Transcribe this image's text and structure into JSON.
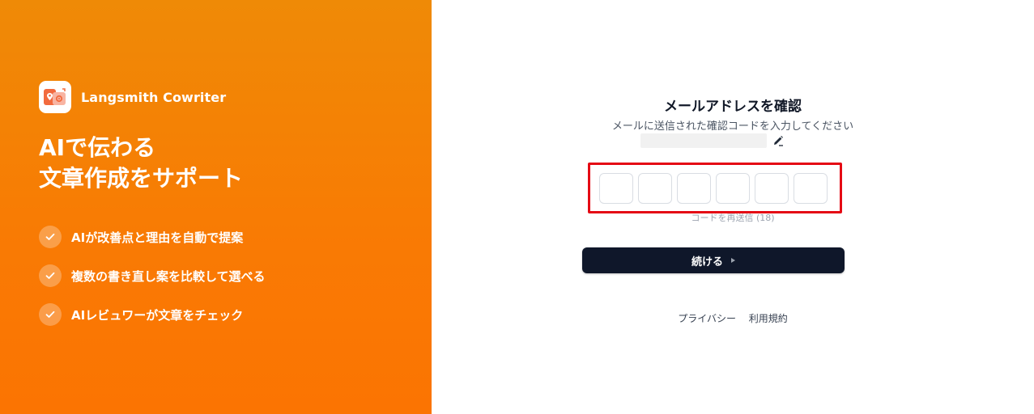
{
  "brand": {
    "name": "Langsmith Cowriter",
    "logo_icon": "app-logo-icon"
  },
  "hero": {
    "line1": "AIで伝わる",
    "line2": "文章作成をサポート"
  },
  "features": [
    {
      "text": "AIが改善点と理由を自動で提案",
      "icon": "check-icon"
    },
    {
      "text": "複数の書き直し案を比較して選べる",
      "icon": "check-icon"
    },
    {
      "text": "AIレビュワーが文章をチェック",
      "icon": "check-icon"
    }
  ],
  "verify": {
    "title": "メールアドレスを確認",
    "subtitle": "メールに送信された確認コードを入力してください",
    "edit_icon": "pencil-icon",
    "code": [
      "",
      "",
      "",
      "",
      "",
      ""
    ],
    "resend_label": "コードを再送信",
    "resend_count": "(18)",
    "continue_label": "続ける",
    "continue_icon": "play-arrow-icon"
  },
  "footer": {
    "privacy": "プライバシー",
    "terms": "利用規約"
  },
  "colors": {
    "accent": "#f97a04",
    "button": "#0f172a",
    "highlight": "#e50914"
  }
}
